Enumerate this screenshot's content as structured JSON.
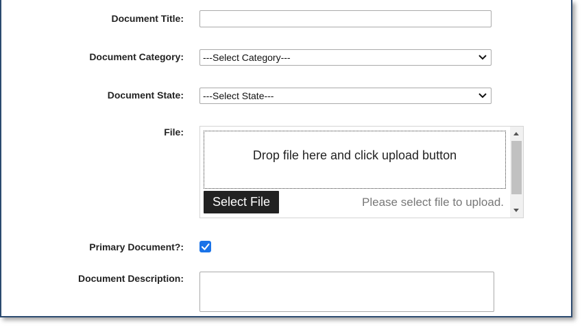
{
  "form": {
    "title_label": "Document Title:",
    "title_value": "",
    "category_label": "Document Category:",
    "category_selected": "---Select Category---",
    "state_label": "Document State:",
    "state_selected": "---Select State---",
    "file_label": "File:",
    "drop_text": "Drop file here and click upload button",
    "select_file_label": "Select File",
    "upload_hint": "Please select file to upload.",
    "primary_label": "Primary Document?:",
    "primary_checked": true,
    "description_label": "Document Description:",
    "description_value": ""
  },
  "colors": {
    "border": "#2b4a6f",
    "checkbox": "#1a73e8",
    "button": "#222222"
  },
  "icons": [
    "chevron-down-icon",
    "scroll-up-arrow-icon",
    "scroll-down-arrow-icon",
    "checkmark-icon"
  ]
}
